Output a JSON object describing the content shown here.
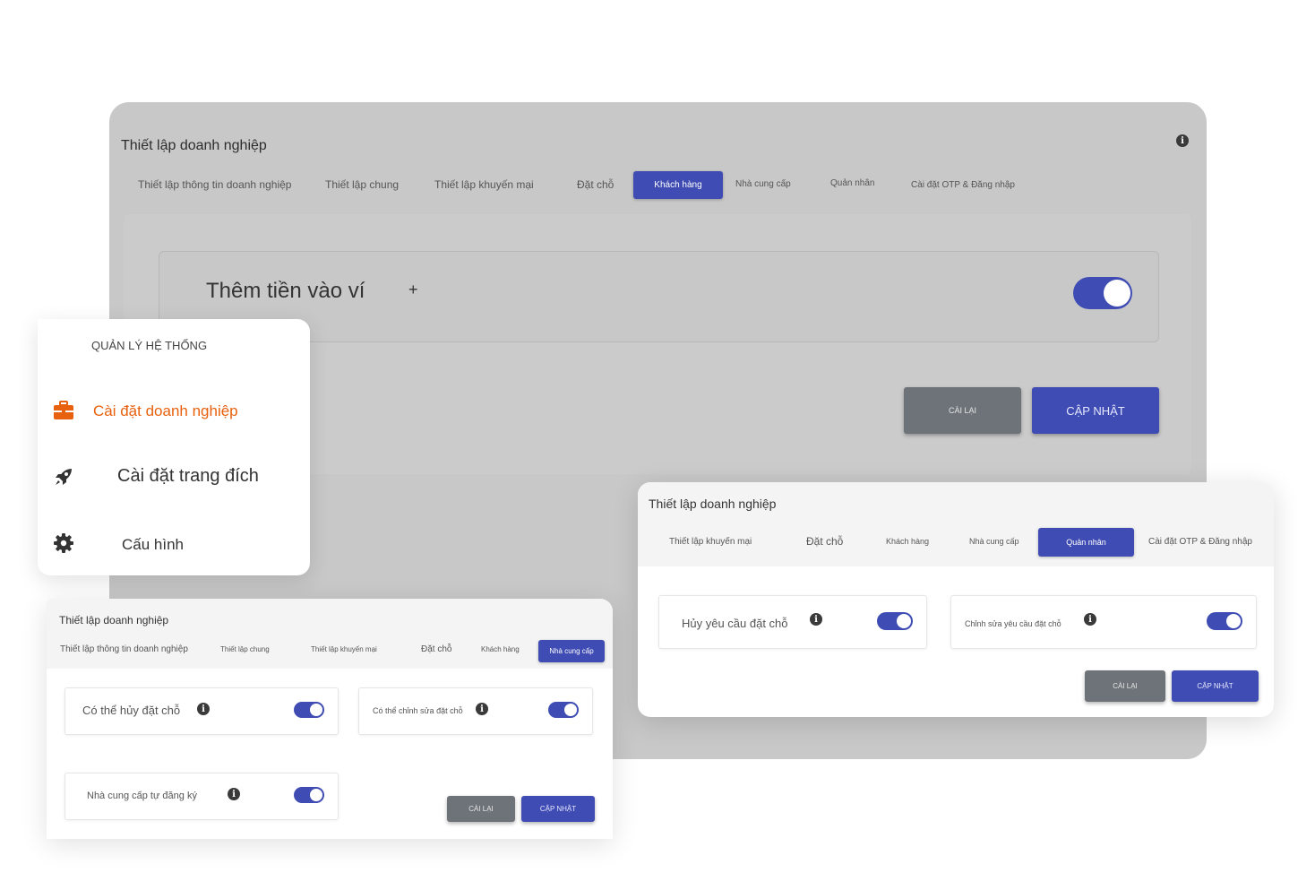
{
  "main": {
    "title": "Thiết lập doanh nghiệp",
    "tabs": [
      "Thiết lập thông tin doanh nghiệp",
      "Thiết lập chung",
      "Thiết lập khuyến mại",
      "Đặt chỗ",
      "Khách hàng",
      "Nhà cung cấp",
      "Quản nhân",
      "Cài đặt OTP & Đăng nhập"
    ],
    "active_tab": "Khách hàng",
    "setting_label": "Thêm tiền vào ví",
    "add_symbol": "+",
    "reset_label": "CÀI LẠI",
    "update_label": "CẬP NHẬT"
  },
  "menu": {
    "section_title": "QUẢN LÝ HỆ THỐNG",
    "items": [
      {
        "label": "Cài đặt doanh nghiệp",
        "icon": "briefcase-icon",
        "active": true
      },
      {
        "label": "Cài đặt trang đích",
        "icon": "rocket-icon",
        "active": false
      },
      {
        "label": "Cấu hình",
        "icon": "gear-icon",
        "active": false
      }
    ]
  },
  "card_left": {
    "title": "Thiết lập doanh nghiệp",
    "tabs": [
      "Thiết lập thông tin doanh nghiệp",
      "Thiết lập chung",
      "Thiết lập khuyến mại",
      "Đặt chỗ",
      "Khách hàng",
      "Nhà cung cấp"
    ],
    "active_tab": "Nhà cung cấp",
    "settings": [
      "Có thể hủy đặt chỗ",
      "Có thể chỉnh sửa đặt chỗ",
      "Nhà cung cấp tự đăng ký"
    ],
    "reset_label": "CÀI LẠI",
    "update_label": "CẬP NHẬT"
  },
  "card_right": {
    "title": "Thiết lập doanh nghiệp",
    "tabs": [
      "Thiết lập khuyến mại",
      "Đặt chỗ",
      "Khách hàng",
      "Nhà cung cấp",
      "Quản nhân",
      "Cài đặt OTP & Đăng nhập"
    ],
    "active_tab": "Quản nhân",
    "settings": [
      "Hủy yêu cầu đặt chỗ",
      "Chỉnh sửa yêu cầu đặt chỗ"
    ],
    "reset_label": "CÀI LẠI",
    "update_label": "CẬP NHẬT"
  },
  "colors": {
    "accent": "#3f4cb3",
    "menu_active": "#e8610e",
    "reset_button": "#6d7378",
    "panel_bg": "#c8c8c8"
  }
}
